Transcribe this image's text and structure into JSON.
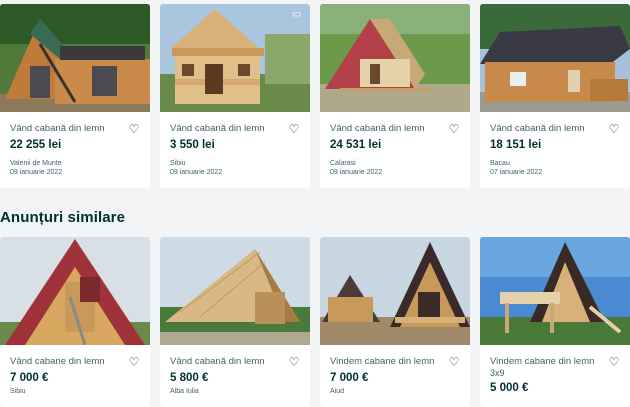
{
  "top_listings": [
    {
      "title": "Vând cabană din lemn",
      "price": "22 255 lei",
      "location": "Valenii de Munte",
      "date": "09 ianuarie 2022"
    },
    {
      "title": "Vând cabană din lemn",
      "price": "3 550 lei",
      "location": "Sibiu",
      "date": "09 ianuarie 2022"
    },
    {
      "title": "Vând cabană din lemn",
      "price": "24 531 lei",
      "location": "Calarasi",
      "date": "09 ianuarie 2022"
    },
    {
      "title": "Vând cabană din lemn",
      "price": "18 151 lei",
      "location": "Bacau",
      "date": "07 ianuarie 2022"
    }
  ],
  "section": {
    "title": "Anunțuri similare"
  },
  "similar_listings": [
    {
      "title": "Vând cabane din lemn",
      "price": "7 000 €",
      "location": "Sibiu"
    },
    {
      "title": "Vând cabană din lemn",
      "price": "5 800 €",
      "location": "Alba Iulia"
    },
    {
      "title": "Vindem cabane din lemn",
      "price": "7 000 €",
      "location": "Aiud"
    },
    {
      "title": "Vindem cabane din lemn",
      "subtitle": "3x9",
      "price": "5 000 €"
    }
  ],
  "icons": {
    "favorite": "heart-outline-icon",
    "delivery": "truck-icon"
  },
  "colors": {
    "text": "#002f34",
    "muted": "#406367",
    "background": "#f2f4f5",
    "card": "#ffffff"
  }
}
